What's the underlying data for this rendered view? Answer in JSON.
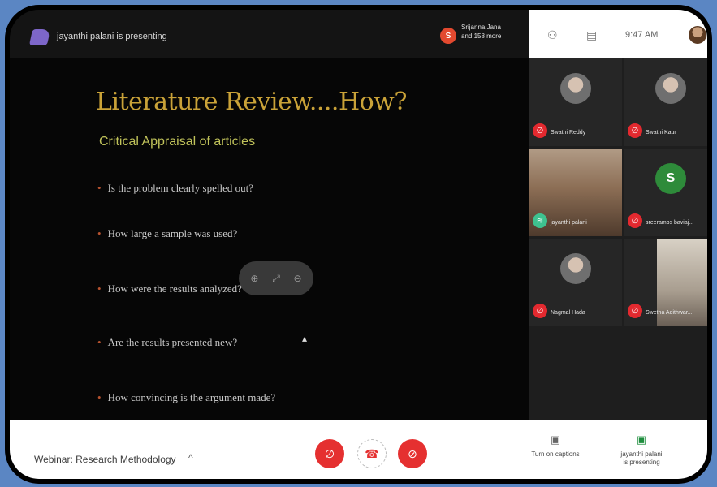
{
  "topbar": {
    "presenting_text": "jayanthi palani is presenting",
    "avatar_letter": "S",
    "participants_line1": "Srijanna Jana",
    "participants_line2": "and 158 more"
  },
  "status": {
    "time": "9:47 AM"
  },
  "slide": {
    "title": "Literature Review....How?",
    "subtitle": "Critical Appraisal of articles",
    "bullets": [
      "Is the problem clearly spelled out?",
      "How large a sample was used?",
      "How were the results analyzed?",
      "Are the results presented new?",
      "How convincing is the argument made?"
    ]
  },
  "participants": [
    {
      "name": "Swathi Reddy",
      "kind": "photo"
    },
    {
      "name": "Swathi Kaur",
      "kind": "photo"
    },
    {
      "name": "jayanthi palani",
      "kind": "video"
    },
    {
      "name": "sreerambs baviaj...",
      "kind": "letter",
      "letter": "S"
    },
    {
      "name": "Nagmal Hada",
      "kind": "photo"
    },
    {
      "name": "Swetha Adithwar...",
      "kind": "video"
    }
  ],
  "bottombar": {
    "meeting_name": "Webinar: Research Methodology",
    "captions_label": "Turn on captions",
    "presenting_label_1": "jayanthi palani",
    "presenting_label_2": "is presenting"
  }
}
